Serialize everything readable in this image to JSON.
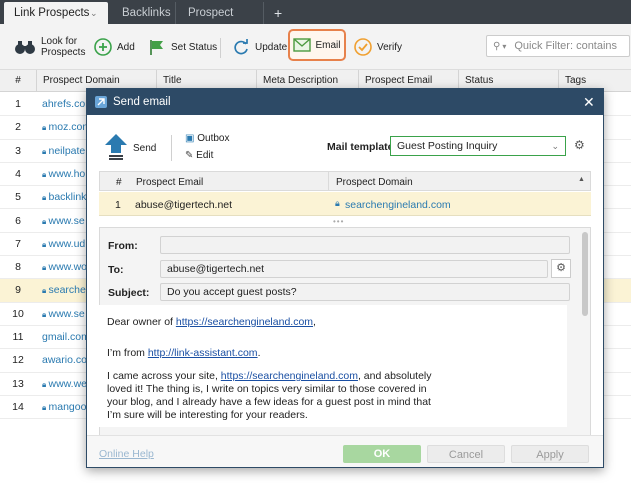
{
  "tabs": [
    {
      "label": "Link Prospects"
    },
    {
      "label": "Backlinks"
    },
    {
      "label": "Prospect quality"
    },
    {
      "label": "+"
    }
  ],
  "toolbar": {
    "look_label_1": "Look for",
    "look_label_2": "Prospects",
    "add_label": "Add",
    "set_status_label": "Set Status",
    "update_label": "Update",
    "email_label": "Email",
    "verify_label": "Verify",
    "filter_placeholder": "Quick Filter: contains"
  },
  "grid": {
    "columns": [
      "#",
      "Prospect Domain",
      "Title",
      "Meta Description",
      "Prospect Email",
      "Status",
      "Tags"
    ],
    "rows": [
      {
        "n": "1",
        "domain": "ahrefs.com",
        "lock": false
      },
      {
        "n": "2",
        "domain": "moz.com",
        "lock": true
      },
      {
        "n": "3",
        "domain": "neilpate",
        "lock": true
      },
      {
        "n": "4",
        "domain": "www.ho",
        "lock": true
      },
      {
        "n": "5",
        "domain": "backlink",
        "lock": true
      },
      {
        "n": "6",
        "domain": "www.se",
        "lock": true
      },
      {
        "n": "7",
        "domain": "www.ud",
        "lock": true
      },
      {
        "n": "8",
        "domain": "www.wo",
        "lock": true
      },
      {
        "n": "9",
        "domain": "searche",
        "lock": true
      },
      {
        "n": "10",
        "domain": "www.se",
        "lock": true
      },
      {
        "n": "11",
        "domain": "gmail.com",
        "lock": false
      },
      {
        "n": "12",
        "domain": "awario.co",
        "lock": false
      },
      {
        "n": "13",
        "domain": "www.we",
        "lock": true
      },
      {
        "n": "14",
        "domain": "mangoo",
        "lock": true
      }
    ],
    "selected_row": "9"
  },
  "dialog": {
    "title": "Send email",
    "send_label": "Send",
    "outbox_label": "Outbox",
    "edit_label": "Edit",
    "template_label": "Mail template",
    "template_value": "Guest Posting Inquiry",
    "recipients": {
      "col_n": "#",
      "col_email": "Prospect Email",
      "col_domain": "Prospect Domain",
      "row_n": "1",
      "row_email": "abuse@tigertech.net",
      "row_domain": "searchengineland.com"
    },
    "from_label": "From:",
    "from_value": "",
    "to_label": "To:",
    "to_value": "abuse@tigertech.net",
    "subject_label": "Subject:",
    "subject_value": "Do you accept guest posts?",
    "body": {
      "greeting_prefix": "Dear owner of ",
      "greeting_link": "https://searchengineland.com",
      "greeting_suffix": ",",
      "from_prefix": "I’m  from ",
      "from_link": "http://link-assistant.com",
      "from_suffix": ".",
      "p3_prefix": "I came across your site, ",
      "p3_link": "https://searchengineland.com",
      "p3_suffix": ", and absolutely",
      "p3_line2": "loved it! The thing is, I write on topics very similar to those covered in",
      "p3_line3": "your blog, and I already have a few ideas for a guest post in mind that",
      "p3_line4": "I’m sure will be interesting for your readers."
    },
    "online_help": "Online Help",
    "ok_label": "OK",
    "cancel_label": "Cancel",
    "apply_label": "Apply"
  },
  "colors": {
    "accent_orange": "#e7814b",
    "title_bar": "#2d4a66",
    "link": "#2a7ab0",
    "selected_row": "#fbf3d5",
    "ok_green": "#a8d7a0"
  }
}
